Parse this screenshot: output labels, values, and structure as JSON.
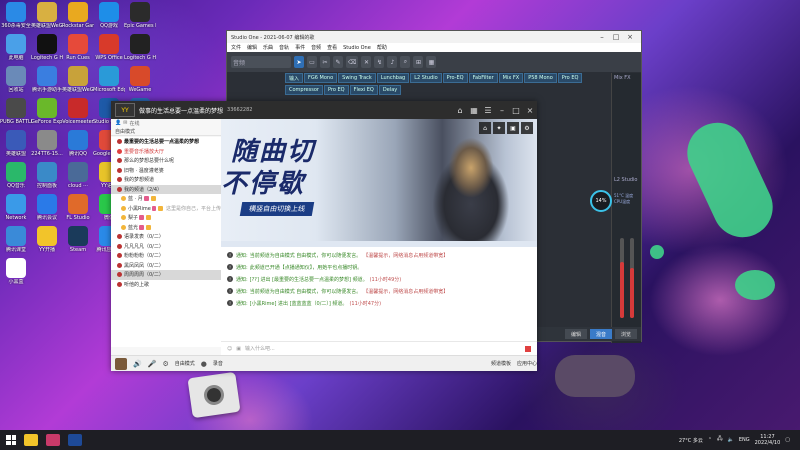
{
  "desktop": {
    "icons": [
      {
        "label": "360杀毒安全",
        "color": "#2a8ae6"
      },
      {
        "label": "英雄联盟WeGame",
        "color": "#d8b041"
      },
      {
        "label": "Rockstar Games",
        "color": "#e9a91f"
      },
      {
        "label": "QQ游戏",
        "color": "#1e8ee8"
      },
      {
        "label": "Epic Games Launcher",
        "color": "#2b2b2b"
      },
      {
        "label": "此电脑",
        "color": "#4aa0e8"
      },
      {
        "label": "Logitech G HUB",
        "color": "#111111"
      },
      {
        "label": "Run Cues",
        "color": "#e64a3a"
      },
      {
        "label": "WPS Office",
        "color": "#d83a2a"
      },
      {
        "label": "Logitech G Hub",
        "color": "#222222"
      },
      {
        "label": "回收站",
        "color": "#6a8ab8"
      },
      {
        "label": "腾讯手游助手",
        "color": "#3a7ee0"
      },
      {
        "label": "英雄联盟WeGame",
        "color": "#c8a23a"
      },
      {
        "label": "Microsoft Edge",
        "color": "#2a9ad8"
      },
      {
        "label": "WeGame",
        "color": "#d84a2a"
      },
      {
        "label": "PUBG BATTLEGR...",
        "color": "#4a4a4a"
      },
      {
        "label": "GeForce Experience",
        "color": "#6ab82a"
      },
      {
        "label": "Voicemeeter",
        "color": "#c82a2a"
      },
      {
        "label": "Studio One 5",
        "color": "#1e5aa8"
      },
      {
        "label": "WeGame",
        "color": "#2a6ab8"
      },
      {
        "label": "英雄联盟",
        "color": "#3a5ab8"
      },
      {
        "label": "224TT6-15...",
        "color": "#8a8a8a"
      },
      {
        "label": "腾讯QQ",
        "color": "#2a7ad8"
      },
      {
        "label": "Google Chrome",
        "color": "#e04a3a"
      },
      {
        "label": "Studio One 5",
        "color": "#1e4a98"
      },
      {
        "label": "QQ音乐",
        "color": "#2ab86a"
      },
      {
        "label": "控制面板",
        "color": "#3a8ac8"
      },
      {
        "label": "cloud ···",
        "color": "#4a6a98"
      },
      {
        "label": "YY语音",
        "color": "#e8c42a"
      },
      {
        "label": "图图视频",
        "color": "#8a6ad8"
      },
      {
        "label": "Network",
        "color": "#3a9ae8"
      },
      {
        "label": "腾讯会议",
        "color": "#2a7ae8"
      },
      {
        "label": "FL Studio",
        "color": "#e06a2a"
      },
      {
        "label": "微信",
        "color": "#2ac84a"
      },
      {
        "label": "YY语音",
        "color": "#f2c42a"
      },
      {
        "label": "腾讯课堂",
        "color": "#3a8ad8"
      },
      {
        "label": "YY开播",
        "color": "#f2c42a"
      },
      {
        "label": "Steam",
        "color": "#1a3a5a"
      },
      {
        "label": "腾讯应用宝",
        "color": "#2a8ae8"
      },
      {
        "label": "YY开播",
        "color": "#2a2a2a"
      },
      {
        "label": "小黑盒",
        "color": "#ffffff"
      }
    ]
  },
  "studio_one": {
    "title": "Studio One - 2021-06-07 编辑的歌",
    "menu": [
      "文件",
      "编辑",
      "乐曲",
      "音轨",
      "事件",
      "音频",
      "查看",
      "Studio One",
      "帮助"
    ],
    "toolbar_field": "音频",
    "tabs": [
      "输入",
      "FG6 Mono",
      "Swing Track",
      "Lunchbag",
      "L2 Studio",
      "Pro-EQ",
      "FabFilter",
      "Mix FX",
      "P58 Mono",
      "Pro EQ",
      "Compressor",
      "Pro EQ",
      "Flexi EQ",
      "Delay"
    ],
    "mix_label": "Mix FX",
    "l2_label": "L2 Studio",
    "bottom_buttons": [
      "编辑",
      "混音",
      "浏览"
    ],
    "cpu_percent": "14%",
    "cpu_info": [
      "51°C 温度",
      "CPU温度"
    ]
  },
  "yy": {
    "title": "做事的生活总要一点温柔的梦想",
    "room_id": "33662282",
    "sub_status": "在线",
    "channel_header": "自由模式",
    "channels": [
      {
        "name": "最重要的生活总要一点温柔的梦想",
        "style": "bold"
      },
      {
        "name": "重要音乐播放大厅",
        "style": "red"
      },
      {
        "name": "那么的梦想总要什么呢",
        "style": "normal"
      },
      {
        "name": "旧物 · 温度灌老婆",
        "style": "normal"
      },
      {
        "name": "我的梦想频道",
        "style": "normal"
      },
      {
        "name": "我的频道（2/4）",
        "style": "selected"
      },
      {
        "name": "蓝 · 月",
        "style": "sub"
      },
      {
        "name": "小黑Rime",
        "style": "sub"
      },
      {
        "name": "梨子",
        "style": "sub"
      },
      {
        "name": "蓝光",
        "style": "sub"
      },
      {
        "name": "语录发表（0/二）",
        "style": "normal"
      },
      {
        "name": "凡凡凡凡（0/二）",
        "style": "normal"
      },
      {
        "name": "粉粉粉粉（0/二）",
        "style": "normal"
      },
      {
        "name": "黑凤凤凤（0/二）",
        "style": "normal"
      },
      {
        "name": "周周周周（0/二）",
        "style": "selected"
      },
      {
        "name": "听他的上歌",
        "style": "normal"
      }
    ],
    "channel_note": "这里是你自己，平台上传",
    "banner_line1": "随曲切",
    "banner_line2": "不停歇",
    "banner_tag": "横竖自由切换上线",
    "messages": [
      {
        "label": "通知:",
        "text": "当前频道为自由模式 自由模式，你可以随便发言。",
        "warn": "【温馨提示，网络消息占用频道带宽】"
      },
      {
        "label": "通知:",
        "text": "此频道已开通【点播通知仪】，用她平也点播时钥。",
        "warn": ""
      },
      {
        "label": "通知:",
        "text": "[??] 进出 [最重要的生活总要一点温柔的梦想] 频道。",
        "warn": "(11小时49分)"
      },
      {
        "label": "通知:",
        "text": "当前频道为自由模式 自由模式，你可以随便发言。",
        "warn": "【温馨提示，网络消息占用频道带宽】"
      },
      {
        "label": "通知:",
        "text": "[小黑Rime] 进出 [蓝蓝蓝蓝（0/二）] 频道。",
        "warn": "(11小时47分)"
      }
    ],
    "input_placeholder": "输入什么吧...",
    "footer": {
      "mode": "自由模式",
      "record": "录音",
      "right1": "频道模板",
      "right2": "应用中心"
    }
  },
  "taskbar": {
    "weather": "27°C 多云",
    "lang": "ENG",
    "time": "11:27",
    "date": "2022/4/10"
  }
}
